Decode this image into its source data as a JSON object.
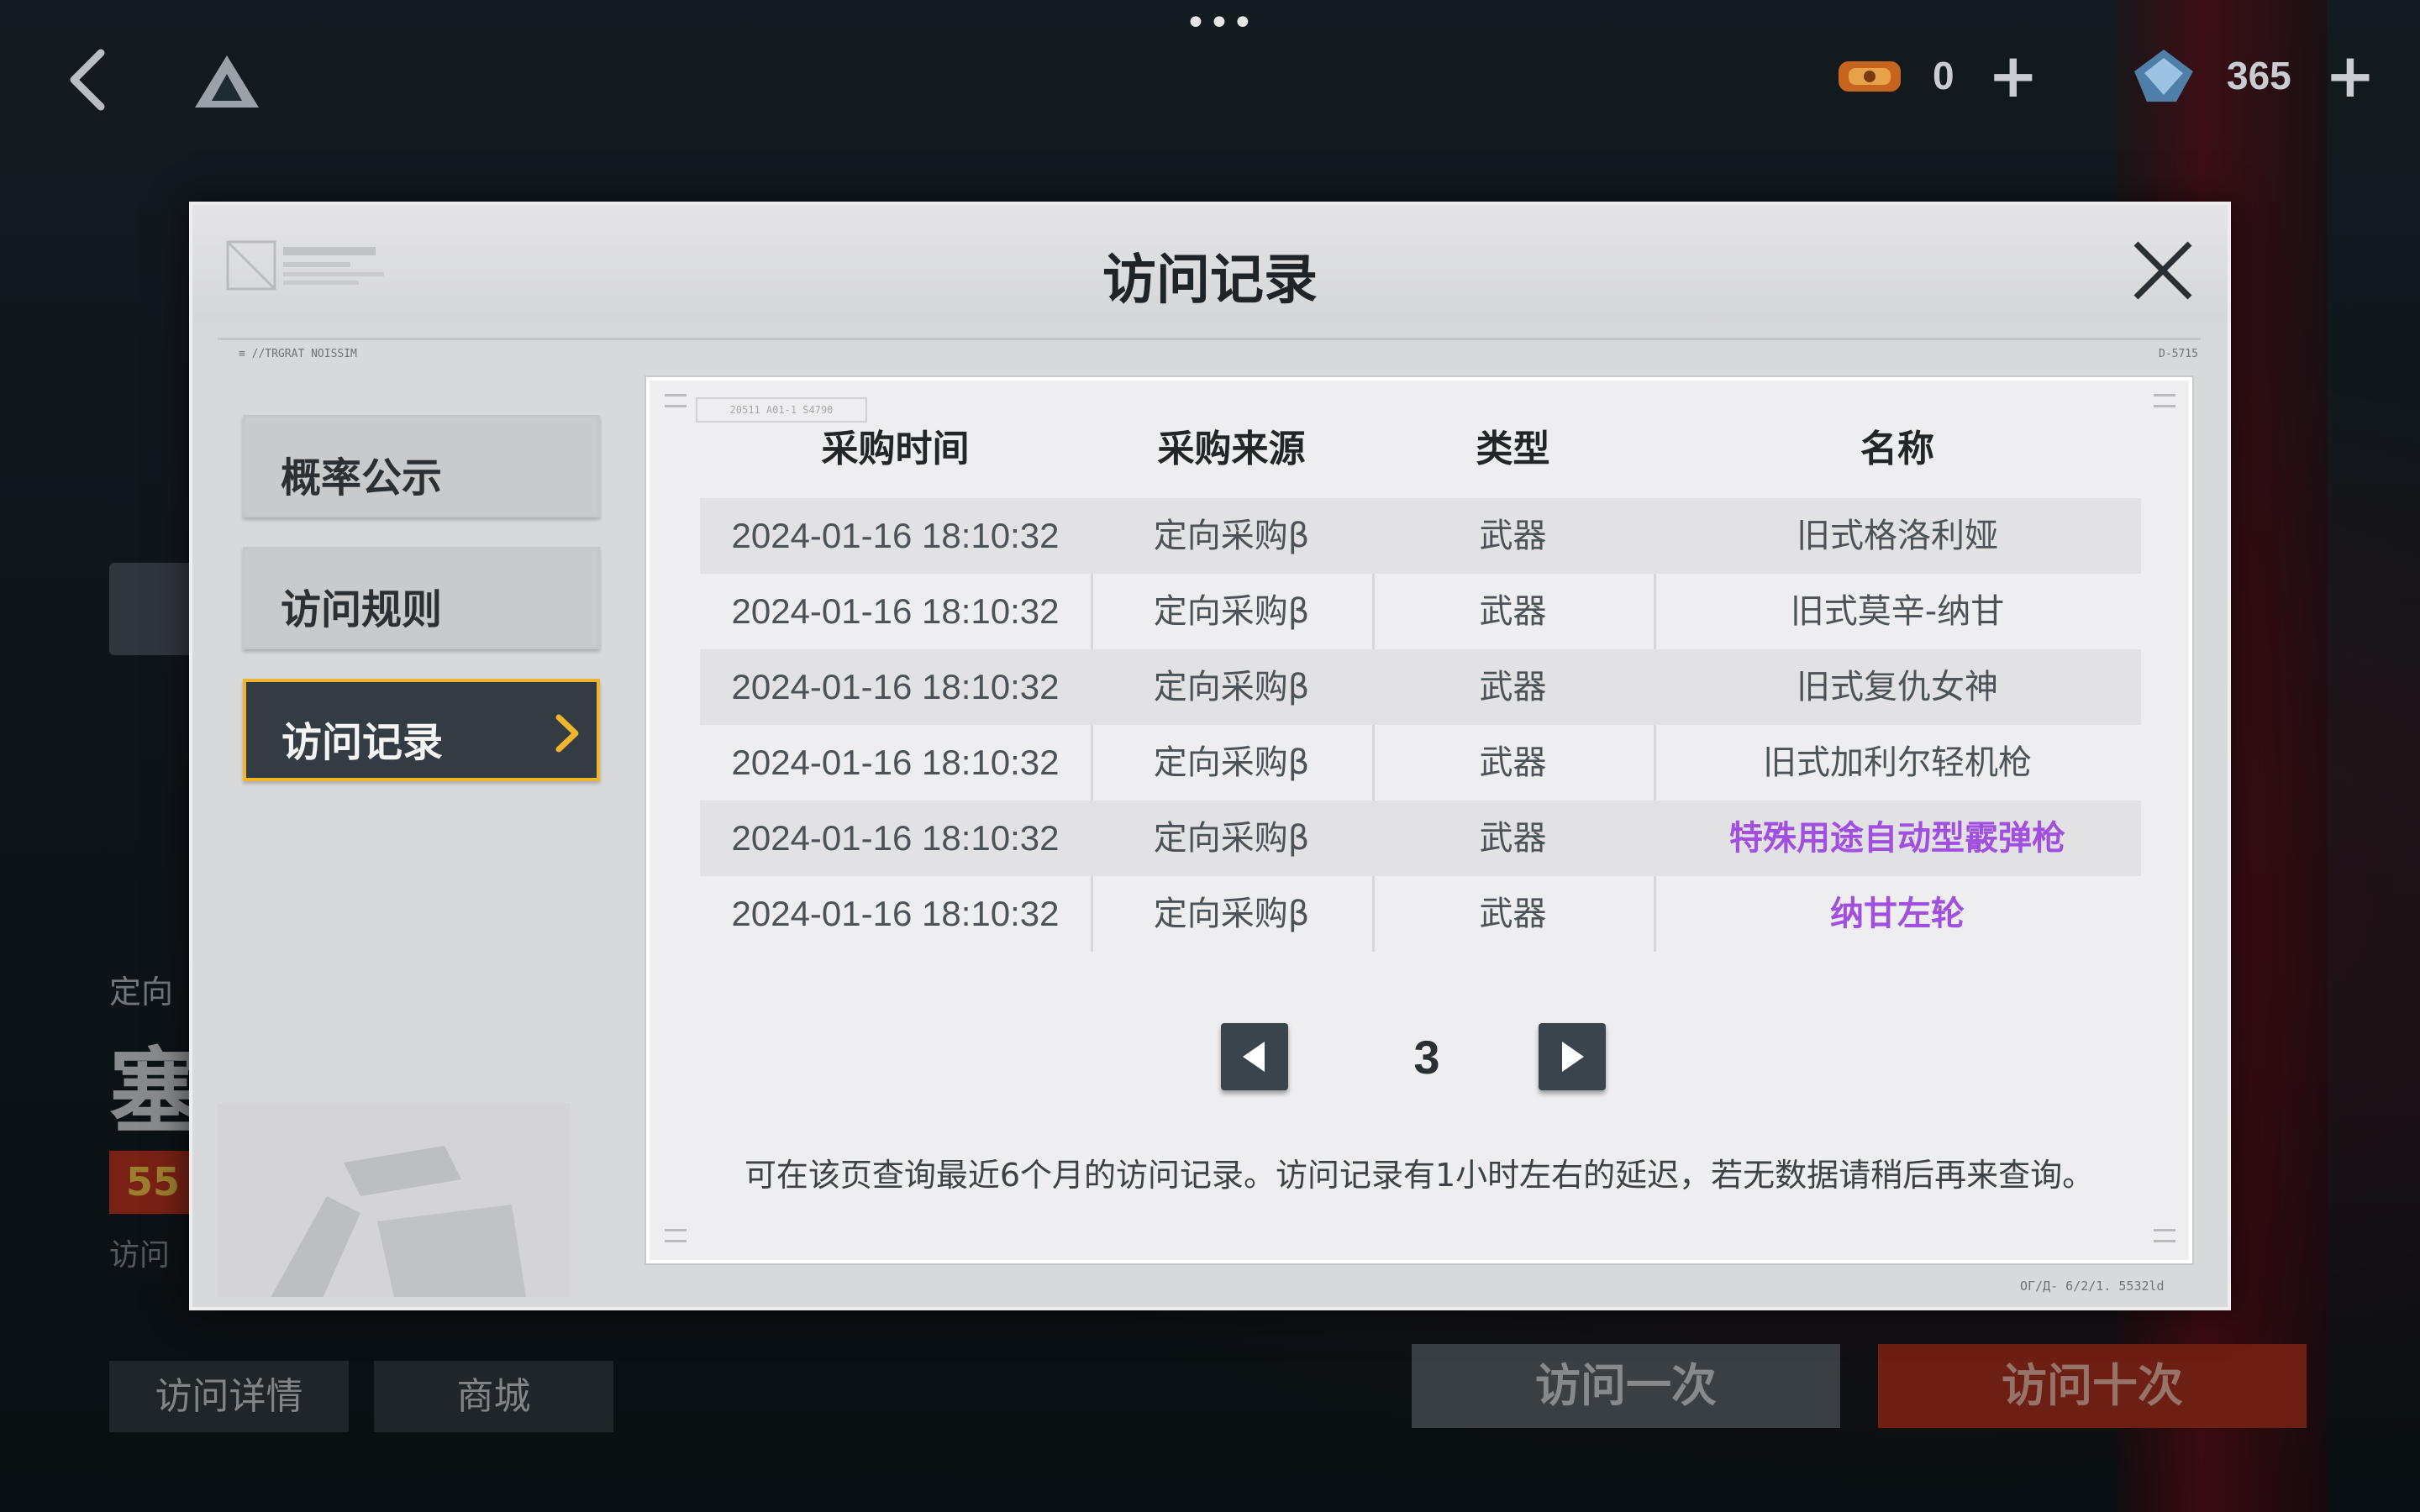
{
  "topbar": {
    "more_dots": "•••",
    "tickets_count": "0",
    "gems_count": "365",
    "plus": "+"
  },
  "background": {
    "banner_prefix": "定向",
    "banner_big": "塞",
    "badge": "55",
    "sub": "访问",
    "details_btn": "访问详情",
    "shop_btn": "商城",
    "visit_once": "访问一次",
    "visit_ten": "访问十次"
  },
  "modal": {
    "title": "访问记录",
    "micro_left": "≡ //TRGRAT NOISSIM",
    "micro_right": "D-5715",
    "micro_bottom_right": "ОГ/Д- 6/2/1. 5532ld",
    "nav": [
      {
        "label": "概率公示"
      },
      {
        "label": "访问规则"
      },
      {
        "label": "访问记录"
      }
    ],
    "panel_tag": "20511  A01-1  S4790",
    "table": {
      "headers": [
        "采购时间",
        "采购来源",
        "类型",
        "名称"
      ],
      "rows": [
        {
          "time": "2024-01-16 18:10:32",
          "source": "定向采购β",
          "type": "武器",
          "name": "旧式格洛利娅"
        },
        {
          "time": "2024-01-16 18:10:32",
          "source": "定向采购β",
          "type": "武器",
          "name": "旧式莫辛-纳甘"
        },
        {
          "time": "2024-01-16 18:10:32",
          "source": "定向采购β",
          "type": "武器",
          "name": "旧式复仇女神"
        },
        {
          "time": "2024-01-16 18:10:32",
          "source": "定向采购β",
          "type": "武器",
          "name": "旧式加利尔轻机枪"
        },
        {
          "time": "2024-01-16 18:10:32",
          "source": "定向采购β",
          "type": "武器",
          "name": "特殊用途自动型霰弹枪"
        },
        {
          "time": "2024-01-16 18:10:32",
          "source": "定向采购β",
          "type": "武器",
          "name": "纳甘左轮"
        }
      ]
    },
    "page": "3",
    "note": "可在该页查询最近6个月的访问记录。访问记录有1小时左右的延迟，若无数据请稍后再来查询。"
  },
  "colors": {
    "accent_gold": "#f0b52c",
    "rare_purple": "#a14fe0",
    "visit_ten_red": "#a8301f"
  }
}
